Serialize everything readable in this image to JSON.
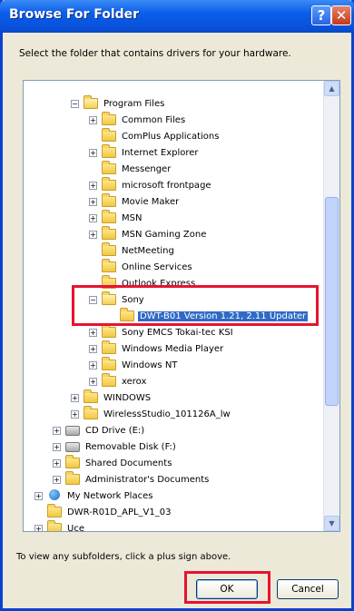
{
  "window": {
    "title": "Browse For Folder",
    "help_glyph": "?",
    "close_glyph": "✕"
  },
  "instruction": "Select the folder that contains drivers for your hardware.",
  "tree": {
    "items": [
      {
        "label": "Program Files",
        "expander": "−",
        "icon": "folder-open-icon"
      },
      {
        "label": "Common Files",
        "expander": "+",
        "icon": "folder-icon"
      },
      {
        "label": "ComPlus Applications",
        "expander": "",
        "icon": "folder-icon"
      },
      {
        "label": "Internet Explorer",
        "expander": "+",
        "icon": "folder-icon"
      },
      {
        "label": "Messenger",
        "expander": "",
        "icon": "folder-icon"
      },
      {
        "label": "microsoft frontpage",
        "expander": "+",
        "icon": "folder-icon"
      },
      {
        "label": "Movie Maker",
        "expander": "+",
        "icon": "folder-icon"
      },
      {
        "label": "MSN",
        "expander": "+",
        "icon": "folder-icon"
      },
      {
        "label": "MSN Gaming Zone",
        "expander": "+",
        "icon": "folder-icon"
      },
      {
        "label": "NetMeeting",
        "expander": "",
        "icon": "folder-icon"
      },
      {
        "label": "Online Services",
        "expander": "",
        "icon": "folder-icon"
      },
      {
        "label": "Outlook Express",
        "expander": "",
        "icon": "folder-icon"
      },
      {
        "label": "Sony",
        "expander": "−",
        "icon": "folder-open-icon"
      },
      {
        "label": "DWT-B01 Version 1.21, 2.11 Updater",
        "expander": "",
        "icon": "folder-icon"
      },
      {
        "label": "Sony EMCS Tokai-tec KSI",
        "expander": "+",
        "icon": "folder-icon"
      },
      {
        "label": "Windows Media Player",
        "expander": "+",
        "icon": "folder-icon"
      },
      {
        "label": "Windows NT",
        "expander": "+",
        "icon": "folder-icon"
      },
      {
        "label": "xerox",
        "expander": "+",
        "icon": "folder-icon"
      },
      {
        "label": "WINDOWS",
        "expander": "+",
        "icon": "folder-icon"
      },
      {
        "label": "WirelessStudio_101126A_lw",
        "expander": "+",
        "icon": "folder-icon"
      },
      {
        "label": "CD Drive (E:)",
        "expander": "+",
        "icon": "cd-drive-icon"
      },
      {
        "label": "Removable Disk (F:)",
        "expander": "+",
        "icon": "removable-disk-icon"
      },
      {
        "label": "Shared Documents",
        "expander": "+",
        "icon": "folder-icon"
      },
      {
        "label": "Administrator's Documents",
        "expander": "+",
        "icon": "folder-icon"
      },
      {
        "label": "My Network Places",
        "expander": "+",
        "icon": "network-icon"
      },
      {
        "label": "DWR-R01D_APL_V1_03",
        "expander": "",
        "icon": "folder-icon"
      },
      {
        "label": "Uce",
        "expander": "+",
        "icon": "folder-icon"
      }
    ],
    "selected": "DWT-B01 Version 1.21, 2.11 Updater"
  },
  "hint": "To view any subfolders, click a plus sign above.",
  "buttons": {
    "ok": "OK",
    "cancel": "Cancel"
  },
  "colors": {
    "titlebar": "#0852dc",
    "selection": "#316ac5",
    "highlight_frame": "#e8132f"
  }
}
